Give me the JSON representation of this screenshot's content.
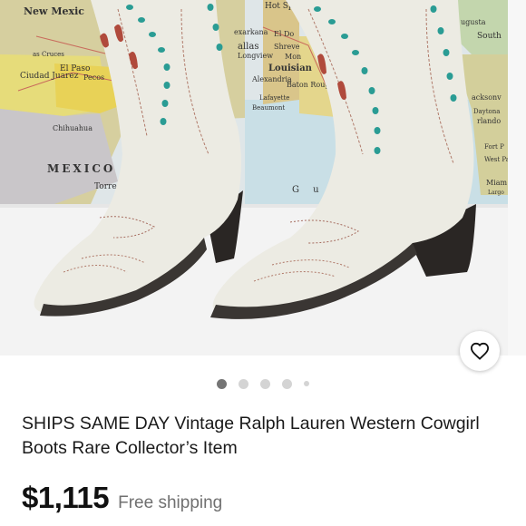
{
  "listing": {
    "title": "SHIPS SAME DAY Vintage Ralph Lauren Western Cowgirl Boots Rare Collector’s Item",
    "price": "$1,115",
    "shipping": "Free shipping"
  },
  "gallery": {
    "total_images": 5,
    "current_index": 0,
    "map_labels": {
      "new_mexico": "New Mexic",
      "hot_springs": "Hot Springs",
      "texarkana": "exarkana",
      "el_dorado": "El Do",
      "dallas": "allas",
      "shreveport": "Shreve",
      "longview": "Longview",
      "monroe": "Mon",
      "louisiana": "Louisian",
      "el_paso": "El Paso",
      "ciudad_juarez": "Ciudad Juarez",
      "las_cruces": "as Cruces",
      "pecos": "Pecos",
      "alexandria": "Alexandria",
      "baton_rouge": "Baton Rouge",
      "lafayette": "Lafayette",
      "beaumont": "Beaumont",
      "chihuahua": "Chihuahua",
      "mexico": "MEXICO",
      "torreon": "Torreón",
      "augusta": "ugusta",
      "south": "South",
      "jacksonville": "acksonv",
      "daytona": "Daytona",
      "orlando": "rlando",
      "fort_pierce": "Fort P",
      "west_palm": "West Palm",
      "miami": "Miam",
      "key_largo": "Largo",
      "gulf": "G u"
    }
  },
  "colors": {
    "price_text": "#111111",
    "shipping_text": "#707070",
    "dot_active": "#757575",
    "dot_inactive": "#d4d4d4"
  },
  "icons": {
    "favorite": "heart-outline-icon"
  }
}
